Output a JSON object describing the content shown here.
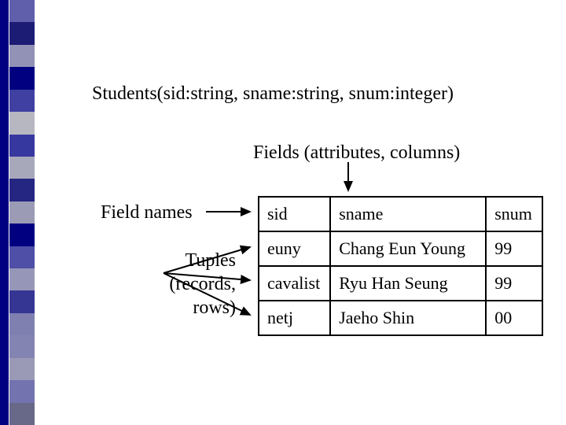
{
  "schema_line": "Students(sid:string, sname:string, snum:integer)",
  "labels": {
    "fields": "Fields (attributes, columns)",
    "field_names": "Field names",
    "tuples_l1": "Tuples",
    "tuples_l2": "(records,",
    "tuples_l3": "rows)"
  },
  "table": {
    "headers": {
      "c1": "sid",
      "c2": "sname",
      "c3": "snum"
    },
    "rows": [
      {
        "c1": "euny",
        "c2": "Chang Eun Young",
        "c3": "99"
      },
      {
        "c1": "cavalist",
        "c2": "Ryu Han Seung",
        "c3": "99"
      },
      {
        "c1": "netj",
        "c2": "Jaeho Shin",
        "c3": "00"
      }
    ]
  },
  "stripes": [
    "#5f5fac",
    "#1c1c75",
    "#9292b6",
    "#000080",
    "#4040a2",
    "#b7b7c2",
    "#3737a0",
    "#a8a8bb",
    "#252582",
    "#9b9bb6",
    "#000080",
    "#4f4fa8",
    "#9697b8",
    "#353593",
    "#7f80b0",
    "#8484b2",
    "#9a9ab6",
    "#7373af",
    "#686888"
  ],
  "chart_data": {
    "type": "table",
    "title": "Students(sid:string, sname:string, snum:integer)",
    "columns": [
      "sid",
      "sname",
      "snum"
    ],
    "rows": [
      [
        "euny",
        "Chang Eun Young",
        99
      ],
      [
        "cavalist",
        "Ryu Han Seung",
        99
      ],
      [
        "netj",
        "Jaeho Shin",
        0
      ]
    ],
    "annotations": {
      "fields_label": "Fields (attributes, columns)",
      "field_names_label": "Field names",
      "tuples_label": "Tuples (records, rows)"
    }
  }
}
